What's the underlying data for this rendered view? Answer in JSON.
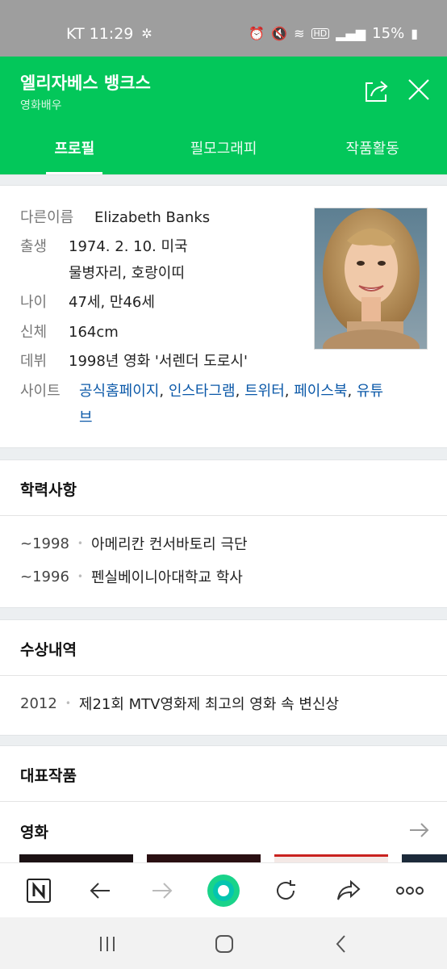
{
  "status_bar": {
    "carrier_time": "KT 11:29",
    "battery": "15%"
  },
  "header": {
    "title": "엘리자베스 뱅크스",
    "subtitle": "영화배우"
  },
  "tabs": [
    {
      "label": "프로필",
      "active": true
    },
    {
      "label": "필모그래피",
      "active": false
    },
    {
      "label": "작품활동",
      "active": false
    }
  ],
  "profile": {
    "other_name_label": "다른이름",
    "other_name_value": "Elizabeth Banks",
    "birth_label": "출생",
    "birth_value_1": "1974. 2. 10. 미국",
    "birth_value_2": "물병자리, 호랑이띠",
    "age_label": "나이",
    "age_value": "47세, 만46세",
    "body_label": "신체",
    "body_value": "164cm",
    "debut_label": "데뷔",
    "debut_value": "1998년 영화 '서렌더 도로시'",
    "site_label": "사이트",
    "sites": [
      "공식홈페이지",
      "인스타그램",
      "트위터",
      "페이스북",
      "유튜브"
    ],
    "site_last_line_1": "유튜",
    "site_last_line_2": "브"
  },
  "education": {
    "title": "학력사항",
    "items": [
      {
        "year": "~1998",
        "text": "아메리칸 컨서바토리 극단"
      },
      {
        "year": "~1996",
        "text": "펜실베이니아대학교 학사"
      }
    ]
  },
  "awards": {
    "title": "수상내역",
    "items": [
      {
        "year": "2012",
        "text": "제21회 MTV영화제 최고의 영화 속 변신상"
      }
    ]
  },
  "works": {
    "title": "대표작품",
    "category": "영화"
  },
  "colors": {
    "brand_green": "#03c75a",
    "link_blue": "#0a58a8"
  }
}
